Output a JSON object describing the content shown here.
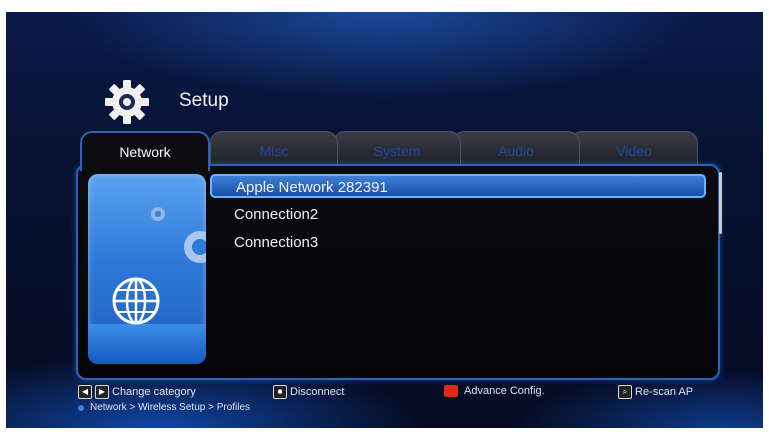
{
  "header": {
    "title": "Setup",
    "icon": "gear-icon"
  },
  "tabs": [
    {
      "label": "Network",
      "active": true
    },
    {
      "label": "Misc",
      "active": false
    },
    {
      "label": "System",
      "active": false
    },
    {
      "label": "Audio",
      "active": false
    },
    {
      "label": "Video",
      "active": false
    }
  ],
  "side_card": {
    "icons": [
      "gear-icon",
      "globe-icon"
    ]
  },
  "list": {
    "items": [
      {
        "label": "Apple Network 282391",
        "selected": true
      },
      {
        "label": "Connection2",
        "selected": false
      },
      {
        "label": "Connection3",
        "selected": false
      }
    ]
  },
  "footer": {
    "change_category": "Change category",
    "disconnect": "Disconnect",
    "advance_config": "Advance Config.",
    "rescan": "Re-scan AP",
    "breadcrumb": "Network > Wireless Setup > Profiles"
  },
  "colors": {
    "accent": "#2a63b8",
    "selected": "#3f7fd6",
    "red_button": "#e0281c"
  }
}
